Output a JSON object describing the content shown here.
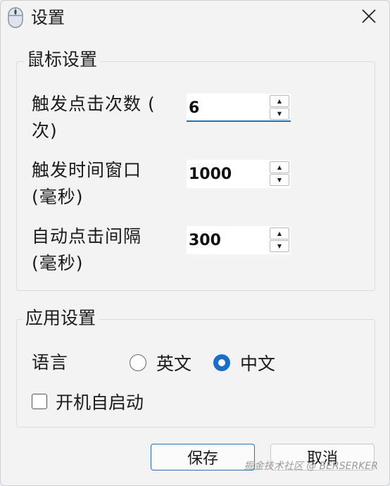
{
  "window": {
    "title": "设置",
    "icon": "mouse-icon",
    "close_icon": "close-icon"
  },
  "mouse_settings": {
    "group_label": "鼠标设置",
    "trigger_clicks": {
      "label_line1": "触发点击次数 (",
      "label_line2": "次)",
      "value": "6"
    },
    "trigger_window": {
      "label_line1": "触发时间窗口",
      "label_line2": "(毫秒)",
      "value": "1000"
    },
    "auto_click_interval": {
      "label_line1": "自动点击间隔",
      "label_line2": "(毫秒)",
      "value": "300"
    }
  },
  "app_settings": {
    "group_label": "应用设置",
    "language_label": "语言",
    "language_options": [
      {
        "label": "英文",
        "selected": false
      },
      {
        "label": "中文",
        "selected": true
      }
    ],
    "autostart": {
      "label": "开机自启动",
      "checked": false
    }
  },
  "buttons": {
    "save_label": "保存",
    "cancel_label": "取消"
  },
  "watermark": "掘金技术社区 @ BERSERKER",
  "colors": {
    "accent": "#1a6ec7",
    "window_bg": "#f3f3f3"
  }
}
